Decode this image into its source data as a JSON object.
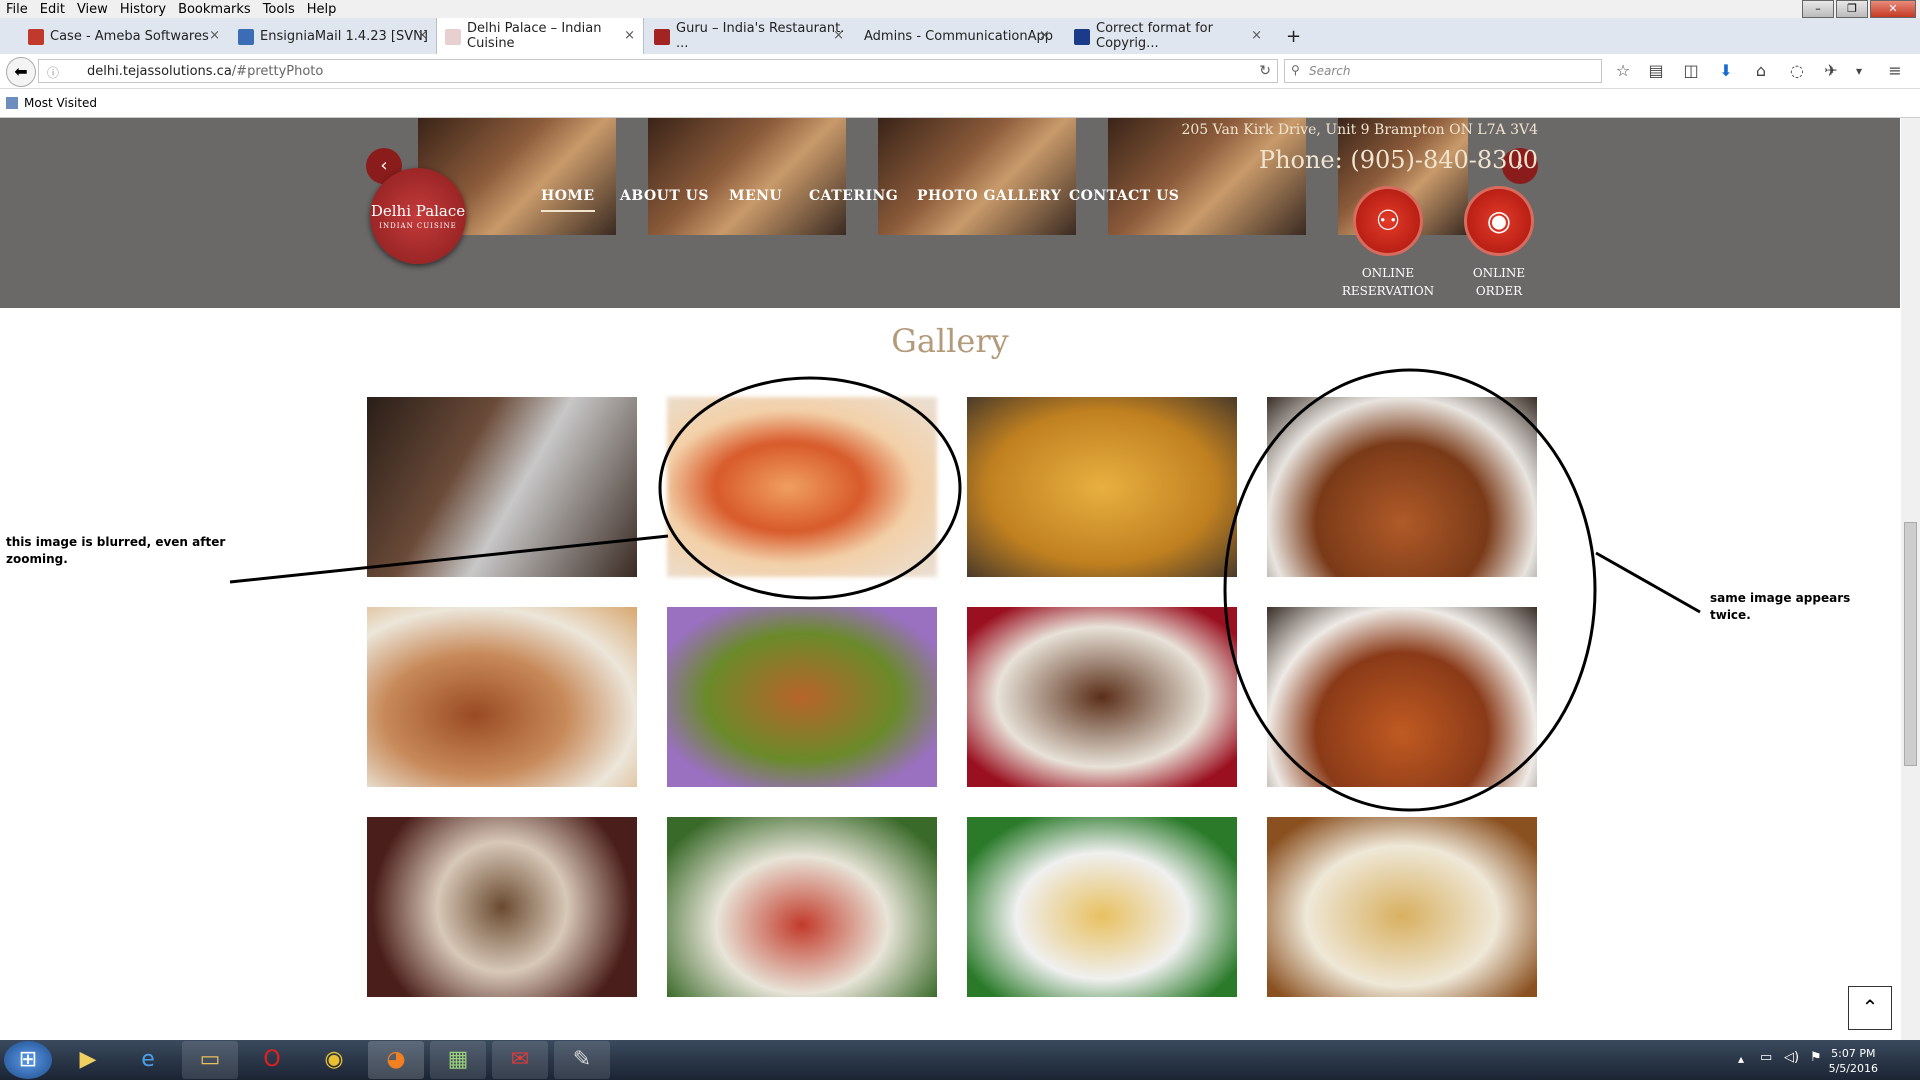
{
  "menubar": {
    "items": [
      "File",
      "Edit",
      "View",
      "History",
      "Bookmarks",
      "Tools",
      "Help"
    ]
  },
  "tabs": [
    {
      "label": "Case - Ameba Softwares",
      "icon_color": "#c0392b"
    },
    {
      "label": "EnsigniaMail 1.4.23 [SVN]",
      "icon_color": "#3a6db5"
    },
    {
      "label": "Delhi Palace – Indian Cuisine",
      "icon_color": "#e8d0d0"
    },
    {
      "label": "Guru – India's Restaurant. ...",
      "icon_color": "#a32222"
    },
    {
      "label": "Admins - CommunicationApp",
      "icon_color": ""
    },
    {
      "label": "Correct format for Copyrig...",
      "icon_color": "#1a3a8a"
    }
  ],
  "tab_close": "×",
  "new_tab": "+",
  "url": {
    "host": "delhi.tejassolutions.ca",
    "path": "/#prettyPhoto"
  },
  "search": {
    "placeholder": "Search"
  },
  "bookmarks": {
    "label": "Most Visited"
  },
  "site": {
    "address": "205 Van Kirk Drive, Unit 9 Brampton ON L7A 3V4",
    "phone": "Phone: (905)-840-8300",
    "logo_title": "Delhi Palace",
    "logo_sub": "INDIAN CUISINE",
    "nav": [
      "HOME",
      "ABOUT US",
      "MENU",
      "CATERING",
      "PHOTO GALLERY",
      "CONTACT US"
    ],
    "reservation": {
      "line1": "ONLINE",
      "line2": "RESERVATION"
    },
    "order": {
      "line1": "ONLINE",
      "line2": "ORDER"
    },
    "gallery_title": "Gallery",
    "scroll_top": "⌃"
  },
  "annotations": {
    "left": "this image is blurred, even after zooming.",
    "right": "same image appears twice."
  },
  "clock": {
    "time": "5:07 PM",
    "date": "5/5/2016"
  },
  "colors": {
    "header_bg": "#6b6868",
    "gallery_title": "#b39a7a",
    "button_red": "#c8281a"
  }
}
